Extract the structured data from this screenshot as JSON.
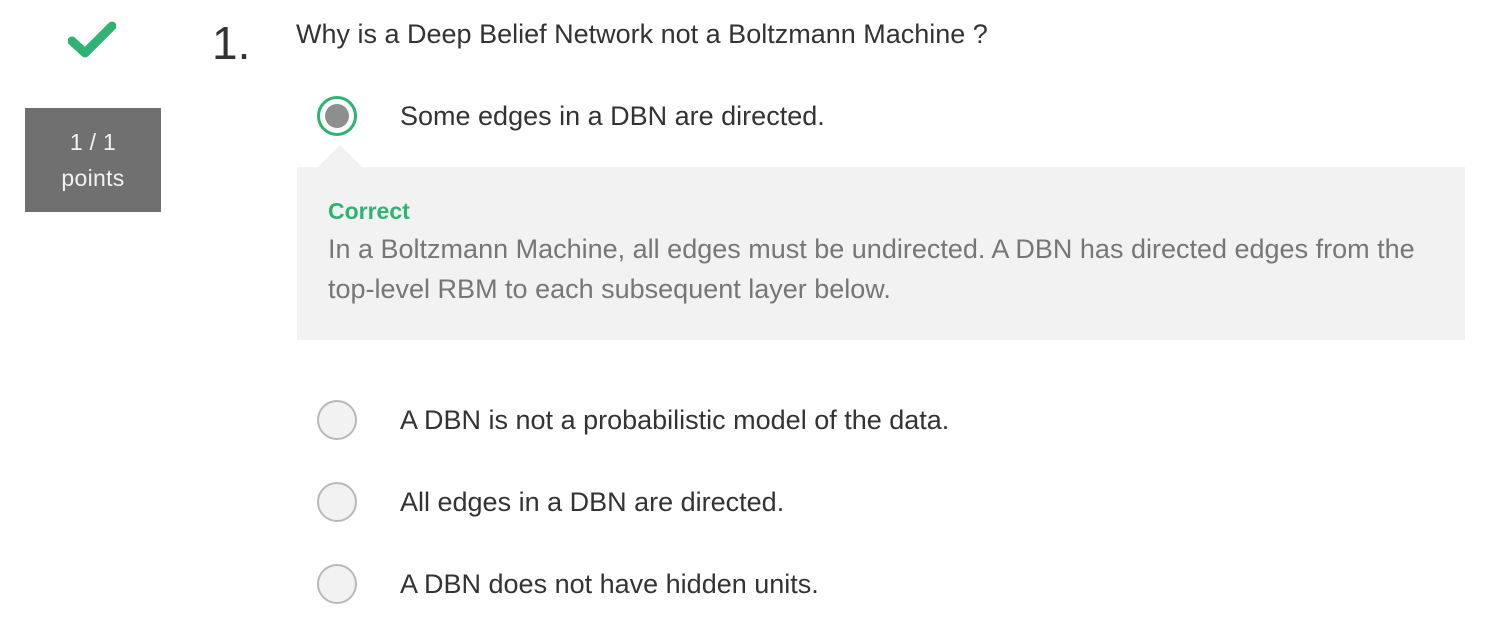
{
  "status": {
    "icon": "checkmark-icon",
    "color": "#2fb372"
  },
  "points": {
    "score": "1 / 1",
    "label": "points"
  },
  "question": {
    "number": "1.",
    "text": "Why is a Deep Belief Network not a Boltzmann Machine ?"
  },
  "options": [
    {
      "label": "Some edges in a DBN are directed.",
      "selected": true
    },
    {
      "label": "A DBN is not a probabilistic model of the data.",
      "selected": false
    },
    {
      "label": "All edges in a DBN are directed.",
      "selected": false
    },
    {
      "label": "A DBN does not have hidden units.",
      "selected": false
    }
  ],
  "feedback": {
    "title": "Correct",
    "text": "In a Boltzmann Machine, all edges must be undirected. A DBN has directed edges from the top-level RBM to each subsequent layer below."
  },
  "colors": {
    "correct": "#2fb372",
    "badge": "#707070",
    "feedback_bg": "#f2f2f2"
  }
}
